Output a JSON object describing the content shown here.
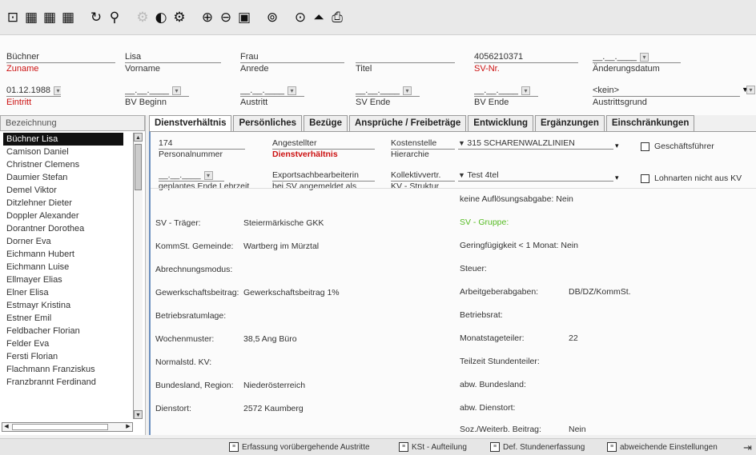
{
  "toolbar": {
    "icons": [
      "chart-icon",
      "calendar-icon",
      "calendar-icon",
      "calendar-icon",
      "refresh-icon",
      "search-icon",
      "settings-disabled-icon",
      "circle-icon",
      "gear-icon",
      "add-icon",
      "remove-icon",
      "save-icon",
      "history-icon",
      "play-icon",
      "upload-icon",
      "print-icon"
    ]
  },
  "header": {
    "surname": {
      "value": "Büchner",
      "label": "Zuname"
    },
    "firstname": {
      "value": "Lisa",
      "label": "Vorname"
    },
    "salutation": {
      "value": "Frau",
      "label": "Anrede"
    },
    "title": {
      "value": "",
      "label": "Titel"
    },
    "sv_nr": {
      "value": "4056210371",
      "label": "SV-Nr."
    },
    "change_date": {
      "value": "__.__.____",
      "label": "Änderungsdatum"
    },
    "entry": {
      "value": "01.12.1988",
      "label": "Eintritt"
    },
    "bv_begin": {
      "value": "__.__.____",
      "label": "BV Beginn"
    },
    "exit": {
      "value": "__.__.____",
      "label": "Austritt"
    },
    "sv_end": {
      "value": "__.__.____",
      "label": "SV Ende"
    },
    "bv_end": {
      "value": "__.__.____",
      "label": "BV Ende"
    },
    "exit_reason": {
      "value": "<kein>",
      "label": "Austrittsgrund"
    }
  },
  "list": {
    "header": "Bezeichnung",
    "items": [
      "Büchner Lisa",
      "Camison Daniel",
      "Christner Clemens",
      "Daumier Stefan",
      "Demel Viktor",
      "Ditzlehner Dieter",
      "Doppler Alexander",
      "Dorantner Dorothea",
      "Dorner Eva",
      "Eichmann Hubert",
      "Eichmann Luise",
      "Ellmayer Elias",
      "Elner Elisa",
      "Estmayr Kristina",
      "Estner Emil",
      "Feldbacher Florian",
      "Felder Eva",
      "Fersti Florian",
      "Flachmann Franziskus",
      "Franzbrannt Ferdinand"
    ]
  },
  "tabs": [
    "Dienstverhältnis",
    "Persönliches",
    "Bezüge",
    "Ansprüche / Freibeträge",
    "Entwicklung",
    "Ergänzungen",
    "Einschränkungen"
  ],
  "content": {
    "personnel_number": {
      "value": "174",
      "label": "Personalnummer"
    },
    "employment": {
      "value": "Angestellter",
      "label": "Dienstverhältnis"
    },
    "cost_center": {
      "value": "Kostenstelle",
      "label": "Hierarchie",
      "selected": "315 SCHARENWALZLINIEN"
    },
    "apprentice_end": {
      "value": "__.__.____",
      "label": "geplantes Ende Lehrzeit"
    },
    "sv_registered": {
      "value": "Exportsachbearbeiterin",
      "label": "bei SV angemeldet als"
    },
    "collective": {
      "value": "Kollektivvertr.",
      "label": "KV - Struktur",
      "selected": "Test 4tel"
    },
    "managing_director": "Geschäftsführer",
    "no_wage_types": "Lohnarten nicht aus KV",
    "left_rows": [
      {
        "label": "SV - Träger:",
        "value": "Steiermärkische GKK"
      },
      {
        "label": "KommSt. Gemeinde:",
        "value": "Wartberg im Mürztal"
      },
      {
        "label": "Abrechnungsmodus:",
        "value": ""
      },
      {
        "label": "Gewerkschaftsbeitrag:",
        "value": "Gewerkschaftsbeitrag 1%"
      },
      {
        "label": "Betriebsratumlage:",
        "value": ""
      },
      {
        "label": "Wochenmuster:",
        "value": "38,5 Ang Büro"
      },
      {
        "label": "Normalstd. KV:",
        "value": ""
      },
      {
        "label": "Bundesland, Region:",
        "value": "Niederösterreich"
      },
      {
        "label": "Dienstort:",
        "value": "2572 Kaumberg"
      }
    ],
    "right_rows": [
      {
        "label": "keine Auflösungsabgabe:",
        "value": "Nein"
      },
      {
        "label": "SV - Gruppe:",
        "value": ""
      },
      {
        "label": "Geringfügigkeit < 1 Monat:",
        "value": "Nein"
      },
      {
        "label": "Steuer:",
        "value": ""
      },
      {
        "label": "Arbeitgeberabgaben:",
        "value": "DB/DZ/KommSt."
      },
      {
        "label": "Betriebsrat:",
        "value": ""
      },
      {
        "label": "Monatstageteiler:",
        "value": "22"
      },
      {
        "label": "Teilzeit Stundenteiler:",
        "value": ""
      },
      {
        "label": "abw. Bundesland:",
        "value": ""
      },
      {
        "label": "abw. Dienstort:",
        "value": ""
      },
      {
        "label": "Soz./Weiterb. Beitrag:",
        "value": "Nein"
      }
    ]
  },
  "bottom": {
    "buttons": [
      "Erfassung vorübergehende Austritte",
      "KSt - Aufteilung",
      "Def. Stundenerfassung",
      "abweichende Einstellungen"
    ]
  }
}
